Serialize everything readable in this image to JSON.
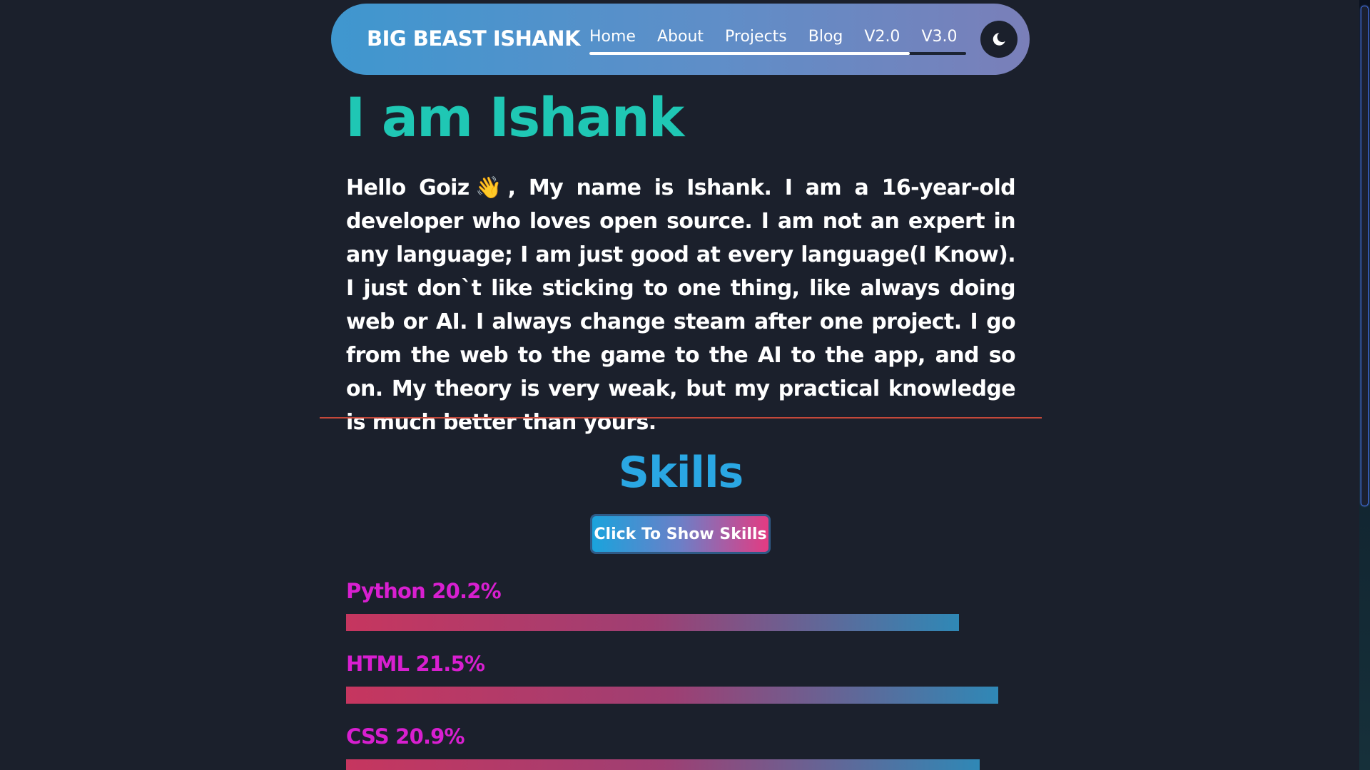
{
  "navbar": {
    "brand": "BIG BEAST ISHANK",
    "links": [
      "Home",
      "About",
      "Projects",
      "Blog",
      "V2.0",
      "V3.0"
    ],
    "progress_fraction": 0.85,
    "theme_icon": "moon-icon"
  },
  "hero": {
    "title": "I am Ishank",
    "intro": "Hello Goiz👋, My name is Ishank. I am a 16-year-old developer who loves open source. I am not an expert in any language; I am just good at every language(I Know). I just don`t like sticking to one thing, like always doing web or AI. I always change steam after one project. I go from the web to the game to the AI to the app, and so on. My theory is very weak, but my practical knowledge is much better than yours."
  },
  "skills": {
    "title": "Skills",
    "button_label": "Click To Show Skills",
    "items": [
      {
        "label": "Python 20.2%",
        "level": 20.2
      },
      {
        "label": "HTML 21.5%",
        "level": 21.5
      },
      {
        "label": "CSS 20.9%",
        "level": 20.9
      }
    ]
  },
  "colors": {
    "background": "#1b202c",
    "hero_title": "#1fc7b4",
    "skills_title": "#2aa7e3",
    "skill_label": "#d81fd0",
    "divider": "#c4483a"
  }
}
